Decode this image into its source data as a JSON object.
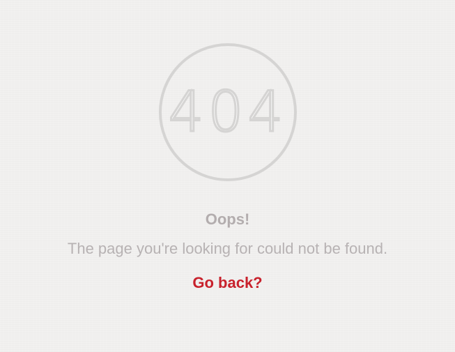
{
  "error": {
    "code": "404",
    "headline": "Oops!",
    "message": "The page you're looking for could not be found.",
    "back_link_label": "Go back?"
  },
  "colors": {
    "background": "#f1f0ef",
    "ring": "#d5d4d3",
    "headline": "#b3adae",
    "message": "#b7b2b3",
    "link": "#c8212c"
  }
}
